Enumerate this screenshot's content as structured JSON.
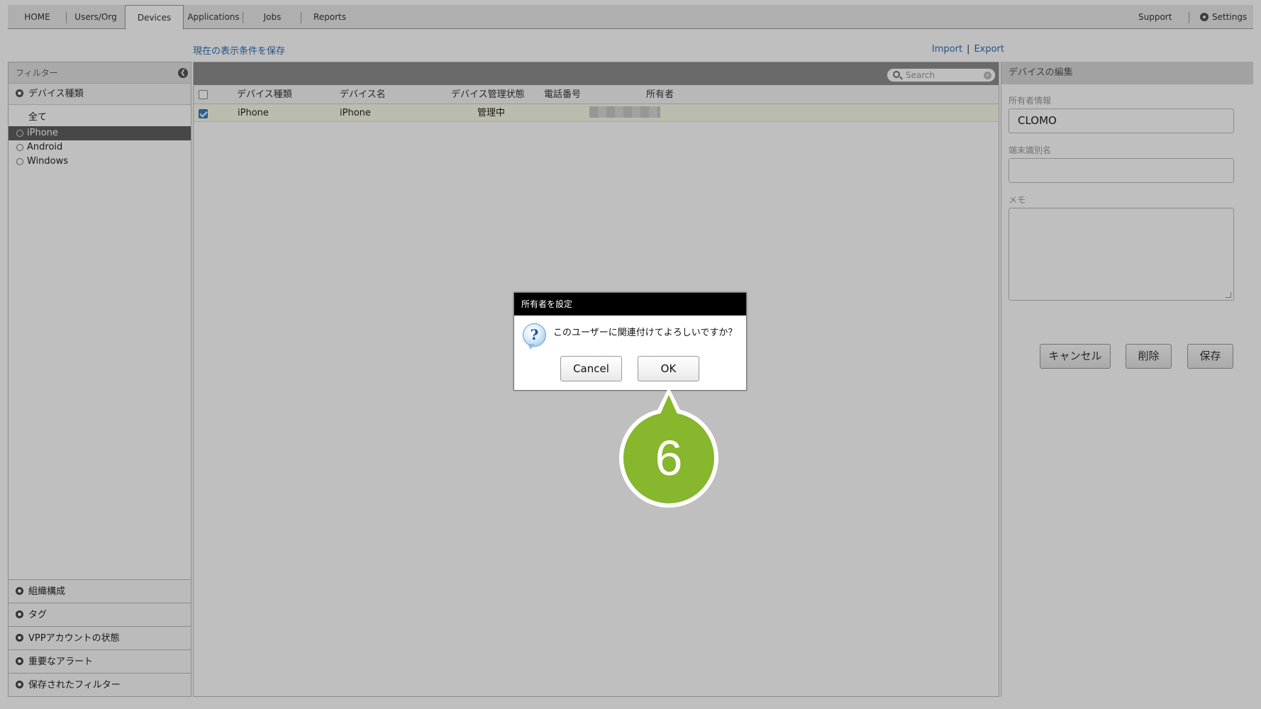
{
  "nav": {
    "tabs": [
      {
        "label": "HOME"
      },
      {
        "label": "Users/Org"
      },
      {
        "label": "Devices"
      },
      {
        "label": "Applications"
      },
      {
        "label": "Jobs"
      },
      {
        "label": "Reports"
      }
    ],
    "support": "Support",
    "settings": "Settings"
  },
  "toolbar": {
    "save_conditions": "現在の表示条件を保存",
    "import": "Import",
    "separator": "|",
    "export": "Export"
  },
  "filter": {
    "title": "フィルター",
    "device_type_header": "デバイス種類",
    "items": [
      {
        "label": "全て"
      },
      {
        "label": "iPhone"
      },
      {
        "label": "Android"
      },
      {
        "label": "Windows"
      }
    ],
    "bottom_sections": [
      {
        "label": "組織構成"
      },
      {
        "label": "タグ"
      },
      {
        "label": "VPPアカウントの状態"
      },
      {
        "label": "重要なアラート"
      },
      {
        "label": "保存されたフィルター"
      }
    ]
  },
  "grid": {
    "search_placeholder": "Search",
    "columns": [
      "デバイス種類",
      "デバイス名",
      "デバイス管理状態",
      "電話番号",
      "所有者"
    ],
    "rows": [
      {
        "type": "iPhone",
        "name": "iPhone",
        "status": "管理中",
        "phone": "",
        "owner": "",
        "checked": true
      }
    ]
  },
  "edit_panel": {
    "title": "デバイスの編集",
    "owner_label": "所有者情報",
    "owner_value": "CLOMO",
    "terminal_label": "端末識別名",
    "terminal_value": "",
    "memo_label": "メモ",
    "buttons": {
      "cancel": "キャンセル",
      "delete": "削除",
      "save": "保存"
    }
  },
  "dialog": {
    "title": "所有者を設定",
    "icon": "question-icon",
    "message": "このユーザーに関連付けてよろしいですか？",
    "cancel_label": "Cancel",
    "ok_label": "OK"
  },
  "callout": {
    "step": "6",
    "color": "#86b72c"
  }
}
